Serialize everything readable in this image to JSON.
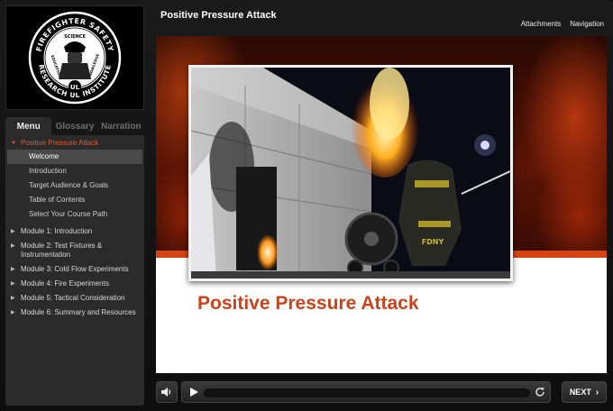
{
  "header": {
    "title": "Positive Pressure Attack",
    "links": [
      "Attachments",
      "Navigation"
    ]
  },
  "logo": {
    "ring_text_top": "FIREFIGHTER SAFETY",
    "ring_text_bottom": "RESEARCH   UL   INSTITUTE",
    "inner_text": [
      "SCIENCE",
      "EDUCATION",
      "KNOWLEDGE"
    ],
    "emblem_text": "UL"
  },
  "tabs": [
    "Menu",
    "Glossary",
    "Narration"
  ],
  "menu": {
    "open_section": "Positive Pressure Attack",
    "sub_items": [
      "Welcome",
      "Introduction",
      "Target Audience & Goals",
      "Table of Contents",
      "Select Your Course Path"
    ],
    "selected_sub_item": "Welcome",
    "modules": [
      "Module 1: Introduction",
      "Module 2: Test Fixtures & Instrumentation",
      "Module 3: Cold Flow Experiments",
      "Module 4: Fire Experiments",
      "Module 5: Tactical Consideration",
      "Module 6: Summary and Resources"
    ]
  },
  "slide": {
    "heading": "Positive Pressure Attack",
    "photo_helmet_text": "FDNY"
  },
  "controls": {
    "next_label": "NEXT",
    "progress": 0
  },
  "colors": {
    "accent": "#e4572e",
    "heading": "#c9441b",
    "band": "#d64415"
  }
}
